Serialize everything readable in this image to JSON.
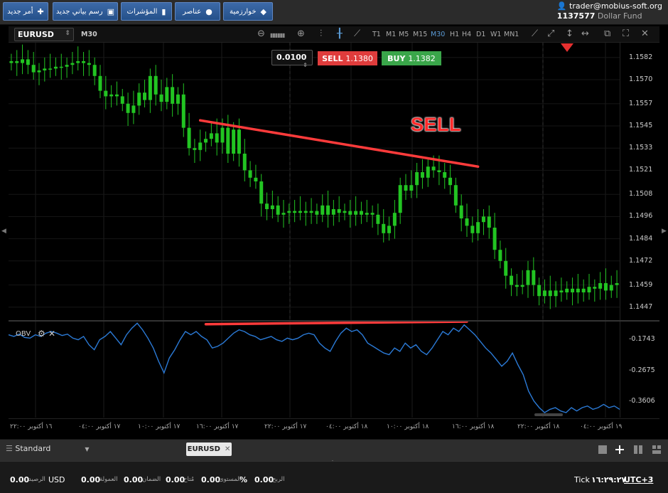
{
  "toolbar": {
    "new_order": "أمر جديد",
    "new_chart": "رسم بياني جديد",
    "indicators": "المؤشرات",
    "elements": "عناصر",
    "algorithms": "خوارزمية"
  },
  "account": {
    "user": "trader@mobius-soft.org",
    "number": "1137577",
    "name": "Dollar Fund"
  },
  "chart_toolbar": {
    "symbol": "EURUSD",
    "timeframe": "M30",
    "timeframes": [
      "T1",
      "M1",
      "M5",
      "M15",
      "M30",
      "H1",
      "H4",
      "D1",
      "W1",
      "MN1"
    ],
    "active_timeframe": "M30"
  },
  "order_panel": {
    "lot": "0.0100",
    "sell_label": "SELL",
    "sell_price": "1.1380",
    "buy_label": "BUY",
    "buy_price": "1.1382"
  },
  "annotation": "SELL",
  "chart_data": {
    "type": "candlestick",
    "symbol": "EURUSD",
    "price_ticks": [
      "1.1582",
      "1.1570",
      "1.1557",
      "1.1545",
      "1.1533",
      "1.1521",
      "1.1508",
      "1.1496",
      "1.1484",
      "1.1472",
      "1.1459",
      "1.1447"
    ],
    "ylim": [
      1.144,
      1.159
    ],
    "candles": [
      [
        1.1579,
        1.158
      ],
      [
        1.158,
        1.1579
      ],
      [
        1.1579,
        1.1581
      ],
      [
        1.1581,
        1.1578
      ],
      [
        1.1578,
        1.1574
      ],
      [
        1.1574,
        1.1575
      ],
      [
        1.1575,
        1.1576
      ],
      [
        1.1576,
        1.1576
      ],
      [
        1.1576,
        1.1577
      ],
      [
        1.1577,
        1.1577
      ],
      [
        1.1577,
        1.1578
      ],
      [
        1.1578,
        1.1579
      ],
      [
        1.1579,
        1.158
      ],
      [
        1.158,
        1.1579
      ],
      [
        1.1579,
        1.1578
      ],
      [
        1.1578,
        1.1572
      ],
      [
        1.1572,
        1.1564
      ],
      [
        1.1564,
        1.1561
      ],
      [
        1.1561,
        1.1562
      ],
      [
        1.1562,
        1.1561
      ],
      [
        1.1561,
        1.1557
      ],
      [
        1.1557,
        1.1552
      ],
      [
        1.1552,
        1.1556
      ],
      [
        1.1556,
        1.1563
      ],
      [
        1.1563,
        1.1559
      ],
      [
        1.1559,
        1.1572
      ],
      [
        1.1572,
        1.1562
      ],
      [
        1.1562,
        1.1558
      ],
      [
        1.1558,
        1.1566
      ],
      [
        1.1566,
        1.1557
      ],
      [
        1.1557,
        1.1562
      ],
      [
        1.1562,
        1.1544
      ],
      [
        1.1544,
        1.1533
      ],
      [
        1.1533,
        1.1532
      ],
      [
        1.1532,
        1.1536
      ],
      [
        1.1536,
        1.1538
      ],
      [
        1.1538,
        1.1541
      ],
      [
        1.1541,
        1.1536
      ],
      [
        1.1536,
        1.1544
      ],
      [
        1.1544,
        1.153
      ],
      [
        1.153,
        1.1543
      ],
      [
        1.1543,
        1.153
      ],
      [
        1.153,
        1.1521
      ],
      [
        1.1521,
        1.1517
      ],
      [
        1.1517,
        1.1515
      ],
      [
        1.1515,
        1.1503
      ],
      [
        1.1503,
        1.15
      ],
      [
        1.15,
        1.1502
      ],
      [
        1.1502,
        1.1497
      ],
      [
        1.1497,
        1.1498
      ],
      [
        1.1498,
        1.1499
      ],
      [
        1.1499,
        1.1498
      ],
      [
        1.1498,
        1.1499
      ],
      [
        1.1499,
        1.1498
      ],
      [
        1.1498,
        1.1499
      ],
      [
        1.1499,
        1.1497
      ],
      [
        1.1497,
        1.1502
      ],
      [
        1.1502,
        1.1497
      ],
      [
        1.1497,
        1.15
      ],
      [
        1.15,
        1.1498
      ],
      [
        1.1498,
        1.1499
      ],
      [
        1.1499,
        1.1497
      ],
      [
        1.1497,
        1.1499
      ],
      [
        1.1499,
        1.1497
      ],
      [
        1.1497,
        1.1498
      ],
      [
        1.1498,
        1.1497
      ],
      [
        1.1497,
        1.1492
      ],
      [
        1.1492,
        1.1487
      ],
      [
        1.1487,
        1.1491
      ],
      [
        1.1491,
        1.1498
      ],
      [
        1.1498,
        1.1513
      ],
      [
        1.1513,
        1.151
      ],
      [
        1.151,
        1.1513
      ],
      [
        1.1513,
        1.152
      ],
      [
        1.152,
        1.1517
      ],
      [
        1.1517,
        1.1523
      ],
      [
        1.1523,
        1.1521
      ],
      [
        1.1521,
        1.152
      ],
      [
        1.152,
        1.1517
      ],
      [
        1.1517,
        1.1513
      ],
      [
        1.1513,
        1.1502
      ],
      [
        1.1502,
        1.1495
      ],
      [
        1.1495,
        1.1491
      ],
      [
        1.1491,
        1.1487
      ],
      [
        1.1487,
        1.1493
      ],
      [
        1.1493,
        1.1496
      ],
      [
        1.1496,
        1.149
      ],
      [
        1.149,
        1.1478
      ],
      [
        1.1478,
        1.1472
      ],
      [
        1.1472,
        1.1464
      ],
      [
        1.1464,
        1.1459
      ],
      [
        1.1459,
        1.1458
      ],
      [
        1.1458,
        1.1459
      ],
      [
        1.1459,
        1.1467
      ],
      [
        1.1467,
        1.1459
      ],
      [
        1.1459,
        1.1453
      ],
      [
        1.1453,
        1.1456
      ],
      [
        1.1456,
        1.1453
      ],
      [
        1.1453,
        1.1456
      ],
      [
        1.1456,
        1.1455
      ],
      [
        1.1455,
        1.1457
      ],
      [
        1.1457,
        1.1455
      ],
      [
        1.1455,
        1.1457
      ],
      [
        1.1457,
        1.1455
      ],
      [
        1.1455,
        1.1458
      ],
      [
        1.1458,
        1.1457
      ],
      [
        1.1457,
        1.146
      ],
      [
        1.146,
        1.1456
      ],
      [
        1.1456,
        1.1459
      ],
      [
        1.1459,
        1.146
      ]
    ],
    "obv": {
      "name": "OBV",
      "ticks": [
        "-0.1743",
        "-0.2675",
        "-0.3606"
      ],
      "ylim": [
        -0.41,
        -0.12
      ],
      "values": [
        -0.16,
        -0.165,
        -0.158,
        -0.168,
        -0.17,
        -0.16,
        -0.165,
        -0.155,
        -0.15,
        -0.155,
        -0.162,
        -0.158,
        -0.17,
        -0.175,
        -0.165,
        -0.19,
        -0.205,
        -0.175,
        -0.165,
        -0.15,
        -0.17,
        -0.19,
        -0.16,
        -0.14,
        -0.125,
        -0.145,
        -0.17,
        -0.2,
        -0.24,
        -0.275,
        -0.23,
        -0.205,
        -0.175,
        -0.15,
        -0.16,
        -0.15,
        -0.165,
        -0.175,
        -0.2,
        -0.195,
        -0.185,
        -0.17,
        -0.155,
        -0.145,
        -0.15,
        -0.16,
        -0.165,
        -0.175,
        -0.17,
        -0.165,
        -0.175,
        -0.18,
        -0.17,
        -0.175,
        -0.17,
        -0.16,
        -0.155,
        -0.16,
        -0.185,
        -0.2,
        -0.21,
        -0.18,
        -0.155,
        -0.14,
        -0.15,
        -0.145,
        -0.16,
        -0.185,
        -0.195,
        -0.205,
        -0.215,
        -0.22,
        -0.2,
        -0.21,
        -0.185,
        -0.2,
        -0.19,
        -0.21,
        -0.22,
        -0.2,
        -0.175,
        -0.15,
        -0.16,
        -0.14,
        -0.15,
        -0.13,
        -0.145,
        -0.16,
        -0.18,
        -0.2,
        -0.215,
        -0.235,
        -0.255,
        -0.24,
        -0.215,
        -0.25,
        -0.28,
        -0.33,
        -0.36,
        -0.38,
        -0.395,
        -0.385,
        -0.38,
        -0.39,
        -0.395,
        -0.38,
        -0.39,
        -0.38,
        -0.375,
        -0.385,
        -0.38,
        -0.37,
        -0.38,
        -0.375,
        -0.385
      ]
    },
    "time_labels": [
      "١٦ أكتوبر ٢٢:٠٠",
      "١٧ أكتوبر ٠٤:٠٠",
      "١٧ أكتوبر ١٠:٠٠",
      "١٧ أكتوبر ١٦:٠٠",
      "١٧ أكتوبر ٢٢:٠٠",
      "١٨ أكتوبر ٠٤:٠٠",
      "١٨ أكتوبر ١٠:٠٠",
      "١٨ أكتوبر ١٦:٠٠",
      "١٨ أكتوبر ٢٢:٠٠",
      "١٩ أكتوبر ٠٤:٠٠"
    ],
    "trendline_price": {
      "from": [
        34,
        1.1548
      ],
      "to": [
        84,
        1.1523
      ]
    },
    "trendline_obv": {
      "from": [
        35,
        -0.128
      ],
      "to": [
        82,
        -0.12
      ]
    }
  },
  "bottom": {
    "layout": "Standard",
    "symbol_tab": "EURUSD",
    "balance_value": "0.00",
    "balance_label": "الرصيد",
    "currency": "USD",
    "commission_value": "0.00",
    "commission_label": "العمولة",
    "margin_value": "0.00",
    "margin_label": "الضمان",
    "free_value": "0.00",
    "free_label": "مُتاح",
    "level_value": "0.00",
    "level_unit": "%",
    "level_label": "المستوى",
    "profit_value": "0.00",
    "profit_label": "الربح",
    "tick_label": "Tick",
    "time": "١٦:٢٩:٢٧",
    "timezone": "UTC+3"
  },
  "colors": {
    "up": "#22c422",
    "down": "#22c422",
    "obv": "#2b7ad6",
    "trend": "#ff3b3b"
  }
}
